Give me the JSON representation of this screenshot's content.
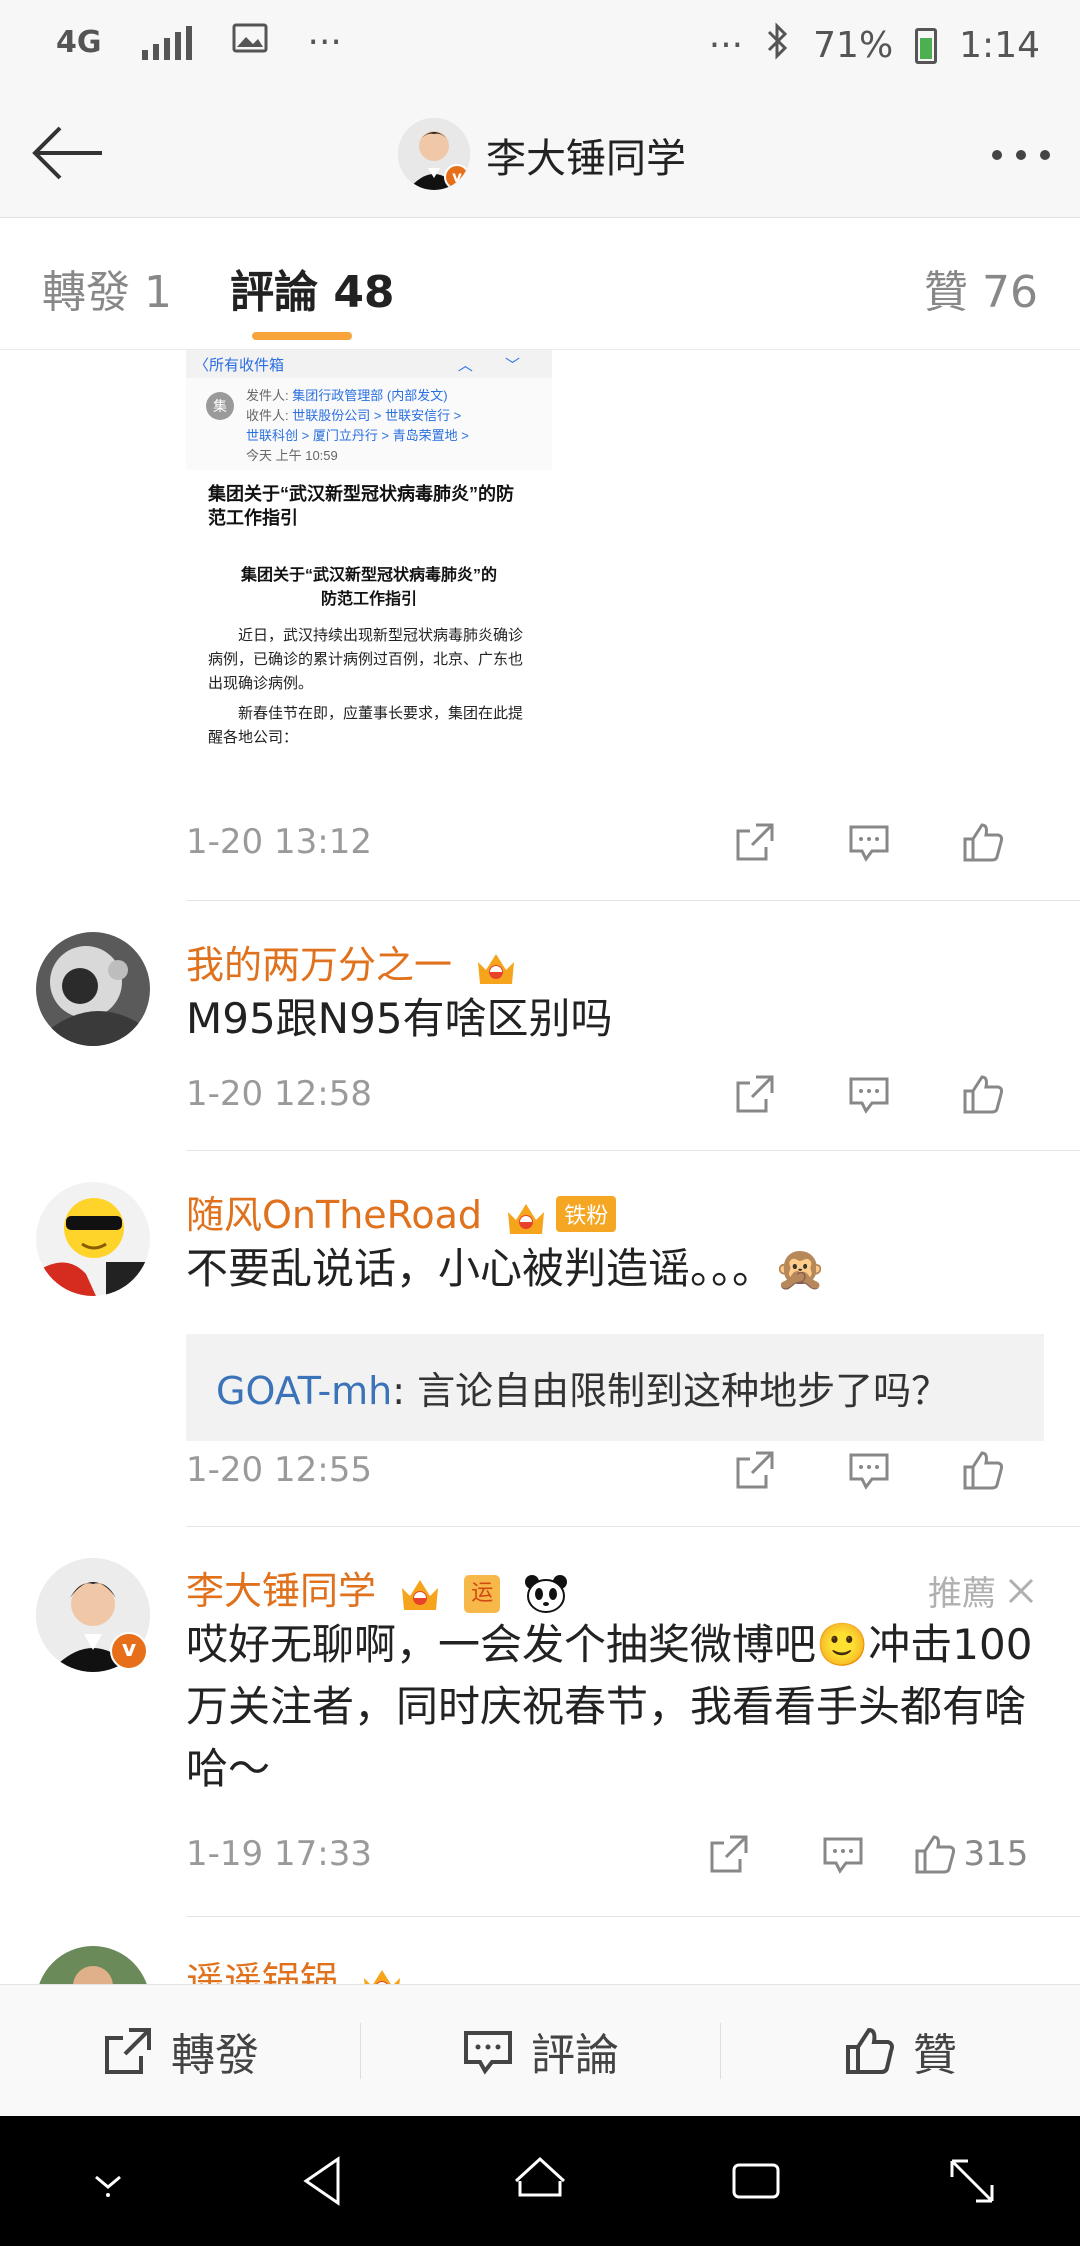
{
  "status_bar": {
    "network": "4G",
    "overflow": "···",
    "overflow_right": "···",
    "battery": "71%",
    "time": "1:14"
  },
  "header": {
    "title": "李大锤同学",
    "back_icon": "back-arrow-icon",
    "more_icon": "more-dots-icon"
  },
  "tabs": [
    {
      "label": "轉發 1"
    },
    {
      "label": "評論 48"
    },
    {
      "label": "贊 76"
    }
  ],
  "attachment": {
    "back_label": "〈所有收件箱",
    "chevrons": "︿ ﹀",
    "avatar_char": "集",
    "sender_label": "发件人:",
    "sender": "集团行政管理部 (内部发文)",
    "recipients_label": "收件人:",
    "recipients_1": "世联股份公司 > 世联安信行 >",
    "recipients_2": "世联科创 > 厦门立丹行 > 青岛荣置地 >",
    "sent_time": "今天 上午 10:59",
    "heading": "集团关于“武汉新型冠状病毒肺炎”的防范工作指引",
    "subheading": "集团关于“武汉新型冠状病毒肺炎”的防范工作指引",
    "para1": "近日，武汉持续出现新型冠状病毒肺炎确诊病例，已确诊的累计病例过百例，北京、广东也出现确诊病例。",
    "para2": "新春佳节在即，应董事长要求，集团在此提醒各地公司：",
    "post_time": "1-20 13:12"
  },
  "comments": [
    {
      "user": "我的两万分之一",
      "text": "M95跟N95有啥区别吗",
      "time": "1-20 12:58"
    },
    {
      "user": "随风OnTheRoad",
      "badge": "铁粉",
      "text": "不要乱说话，小心被判造谣。。。🙊",
      "reply_user": "GOAT-mh",
      "reply_text": ": 言论自由限制到这种地步了吗？",
      "time": "1-20 12:55"
    },
    {
      "user": "李大锤同学",
      "yun_badge": "运",
      "recommend": "推薦",
      "text": "哎好无聊啊，一会发个抽奖微博吧🙂冲击100 万关注者，同时庆祝春节，我看看手头都有啥哈～",
      "time": "1-19 17:33",
      "likes": "315"
    },
    {
      "user": "遥遥锅锅"
    }
  ],
  "toolbar": {
    "repost": "轉發",
    "comment": "評論",
    "like": "贊"
  }
}
